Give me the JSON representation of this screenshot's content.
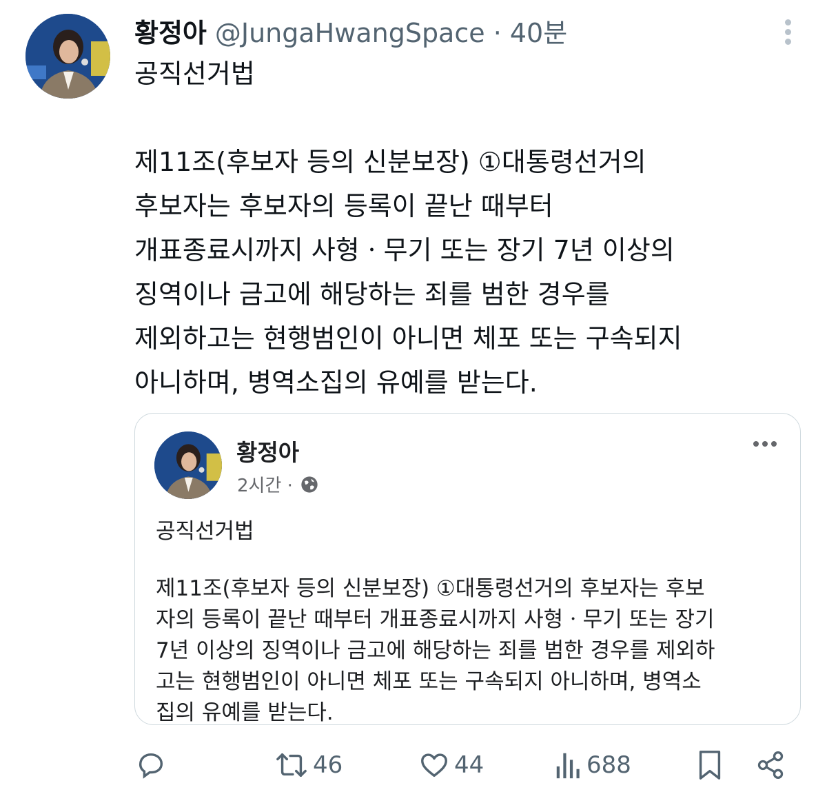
{
  "tweet": {
    "author_name": "황정아",
    "author_handle": "@JungaHwangSpace · 40분",
    "text": "공직선거법\n\n제11조(후보자 등의 신분보장) ①대통령선거의\n후보자는 후보자의 등록이 끝난 때부터\n개표종료시까지 사형ㆍ무기 또는 장기 7년 이상의\n징역이나 금고에 해당하는 죄를 범한 경우를\n제외하고는 현행범인이 아니면 체포 또는 구속되지\n아니하며, 병역소집의 유예를 받는다."
  },
  "quoted": {
    "author_name": "황정아",
    "time": "2시간 ·",
    "title": "공직선거법",
    "text": "제11조(후보자 등의 신분보장) ①대통령선거의 후보자는 후보\n자의 등록이 끝난 때부터 개표종료시까지 사형ㆍ무기 또는 장기\n7년 이상의 징역이나 금고에 해당하는 죄를 범한 경우를 제외하\n고는 현행범인이 아니면 체포 또는 구속되지 아니하며, 병역소\n집의 유예를 받는다."
  },
  "actions": {
    "reply_icon": "reply-icon",
    "retweet_count": "46",
    "like_count": "44",
    "views_count": "688",
    "bookmark_icon": "bookmark-icon",
    "share_icon": "share-icon"
  },
  "colors": {
    "text": "#0f1419",
    "secondary": "#536471",
    "border": "#cfd9de"
  }
}
